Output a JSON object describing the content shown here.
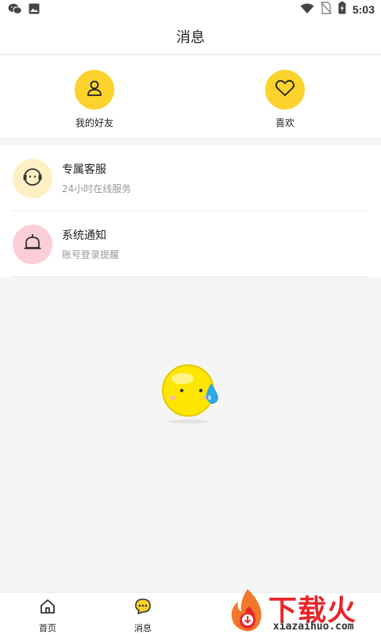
{
  "status_bar": {
    "time": "5:03",
    "icons_left": [
      "wechat-icon",
      "image-icon"
    ],
    "icons_right": [
      "wifi-icon",
      "no-sim-icon",
      "battery-icon"
    ]
  },
  "header": {
    "title": "消息"
  },
  "quick_actions": [
    {
      "label": "我的好友",
      "icon": "user-icon"
    },
    {
      "label": "喜欢",
      "icon": "heart-icon"
    }
  ],
  "messages": [
    {
      "title": "专属客服",
      "subtitle": "24小时在线服务",
      "icon": "customer-service-icon",
      "color": "#fdf0c4"
    },
    {
      "title": "系统通知",
      "subtitle": "账号登录提醒",
      "icon": "bell-icon",
      "color": "#fbcfd5"
    }
  ],
  "bottom_nav": [
    {
      "label": "首页",
      "icon": "home-icon"
    },
    {
      "label": "消息",
      "icon": "chat-icon",
      "active": true
    }
  ],
  "watermark": {
    "text": "下载火",
    "url": "xiazaihuo.com"
  },
  "colors": {
    "accent": "#fcd22c",
    "watermark_red": "#e8262a"
  }
}
